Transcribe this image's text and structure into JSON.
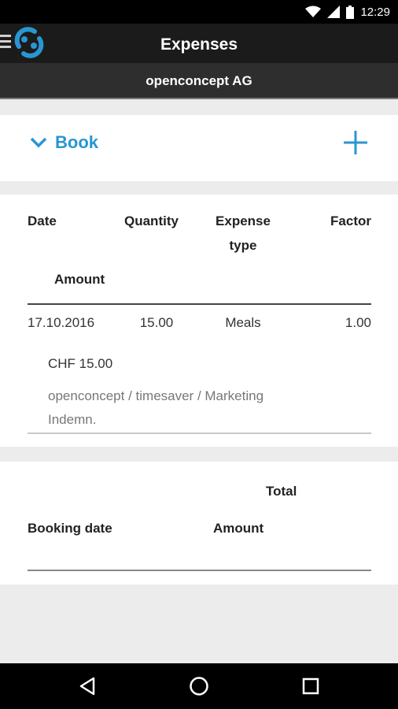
{
  "status_bar": {
    "time": "12:29",
    "icons": [
      "wifi-icon",
      "signal-icon",
      "battery-icon"
    ]
  },
  "app_bar": {
    "title": "Expenses",
    "icons": [
      "menu-icon",
      "app-logo-icon"
    ]
  },
  "sub_bar": {
    "company": "openconcept AG"
  },
  "book_section": {
    "label": "Book",
    "toggle_icon": "chevron-down-icon",
    "add_icon": "plus-icon"
  },
  "expenses_table": {
    "headers": {
      "date": "Date",
      "quantity": "Quantity",
      "expense_type_line1": "Expense",
      "expense_type_line2": "type",
      "factor": "Factor",
      "amount": "Amount"
    },
    "rows": [
      {
        "date": "17.10.2016",
        "quantity": "15.00",
        "expense_type": "Meals",
        "factor": "1.00",
        "amount": "CHF 15.00",
        "description_line1": "openconcept / timesaver / Marketing",
        "description_line2": "Indemn."
      }
    ]
  },
  "totals_table": {
    "headers": {
      "total": "Total",
      "booking_date": "Booking date",
      "amount": "Amount"
    }
  },
  "nav_bar": {
    "icons": [
      "back-icon",
      "home-icon",
      "recents-icon"
    ]
  },
  "colors": {
    "accent": "#2896d3",
    "app_bar": "#1b1b1b",
    "sub_bar": "#2e2e2e",
    "background": "#ececec"
  }
}
